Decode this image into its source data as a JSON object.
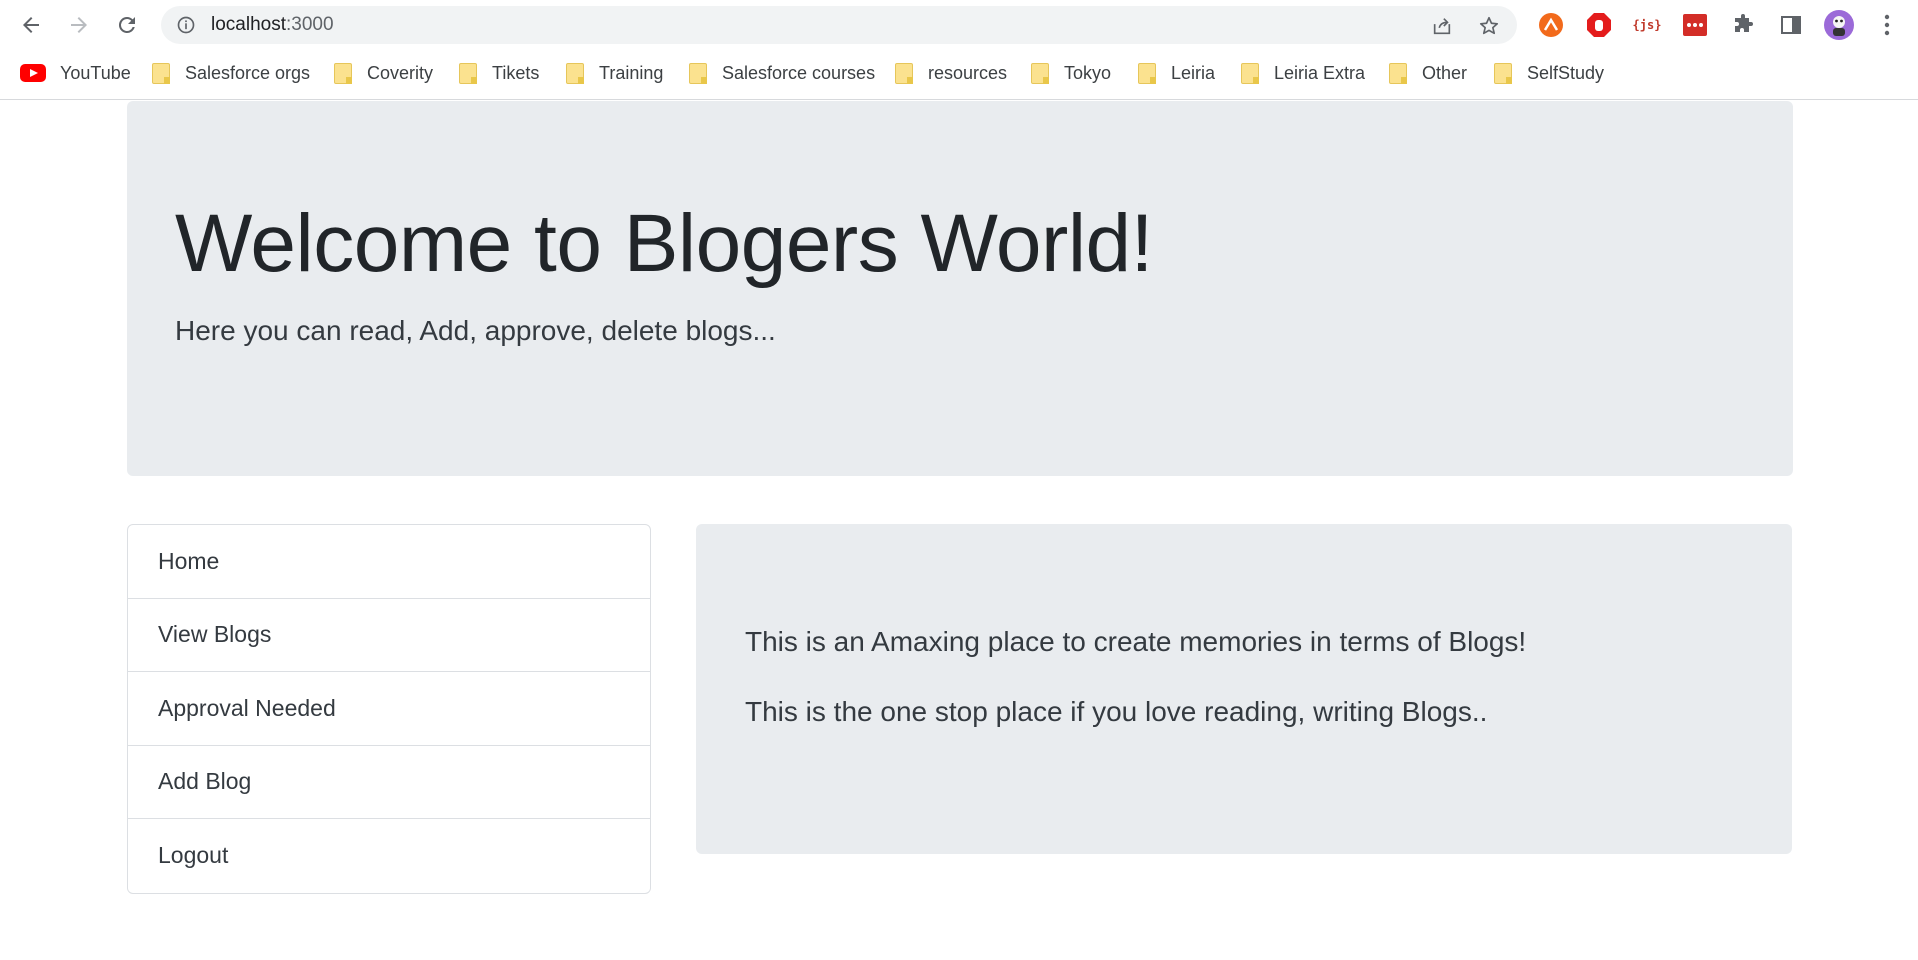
{
  "browser": {
    "url_host": "localhost",
    "url_port": ":3000",
    "bookmarks": [
      {
        "label": "YouTube",
        "icon": "youtube-icon"
      },
      {
        "label": "Salesforce orgs",
        "icon": "folder-icon"
      },
      {
        "label": "Coverity",
        "icon": "folder-icon"
      },
      {
        "label": "Tikets",
        "icon": "folder-icon"
      },
      {
        "label": "Training",
        "icon": "folder-icon"
      },
      {
        "label": "Salesforce courses",
        "icon": "folder-icon"
      },
      {
        "label": "resources",
        "icon": "folder-icon"
      },
      {
        "label": "Tokyo",
        "icon": "folder-icon"
      },
      {
        "label": "Leiria",
        "icon": "folder-icon"
      },
      {
        "label": "Leiria Extra",
        "icon": "folder-icon"
      },
      {
        "label": "Other",
        "icon": "folder-icon"
      },
      {
        "label": "SelfStudy",
        "icon": "folder-icon"
      }
    ],
    "extension_text": "{js}"
  },
  "jumbotron": {
    "title": "Welcome to Blogers World!",
    "lead": "Here you can read, Add, approve, delete blogs..."
  },
  "menu": {
    "items": [
      {
        "label": "Home"
      },
      {
        "label": "View Blogs"
      },
      {
        "label": "Approval Needed"
      },
      {
        "label": "Add Blog"
      },
      {
        "label": "Logout"
      }
    ]
  },
  "content": {
    "line1": "This is an Amaxing place to create memories in terms of Blogs!",
    "line2": "This is the one stop place if you love reading, writing Blogs.."
  },
  "colors": {
    "jumbotron_bg": "#e9ecef",
    "border": "#dcdfe3",
    "text": "#212529"
  }
}
